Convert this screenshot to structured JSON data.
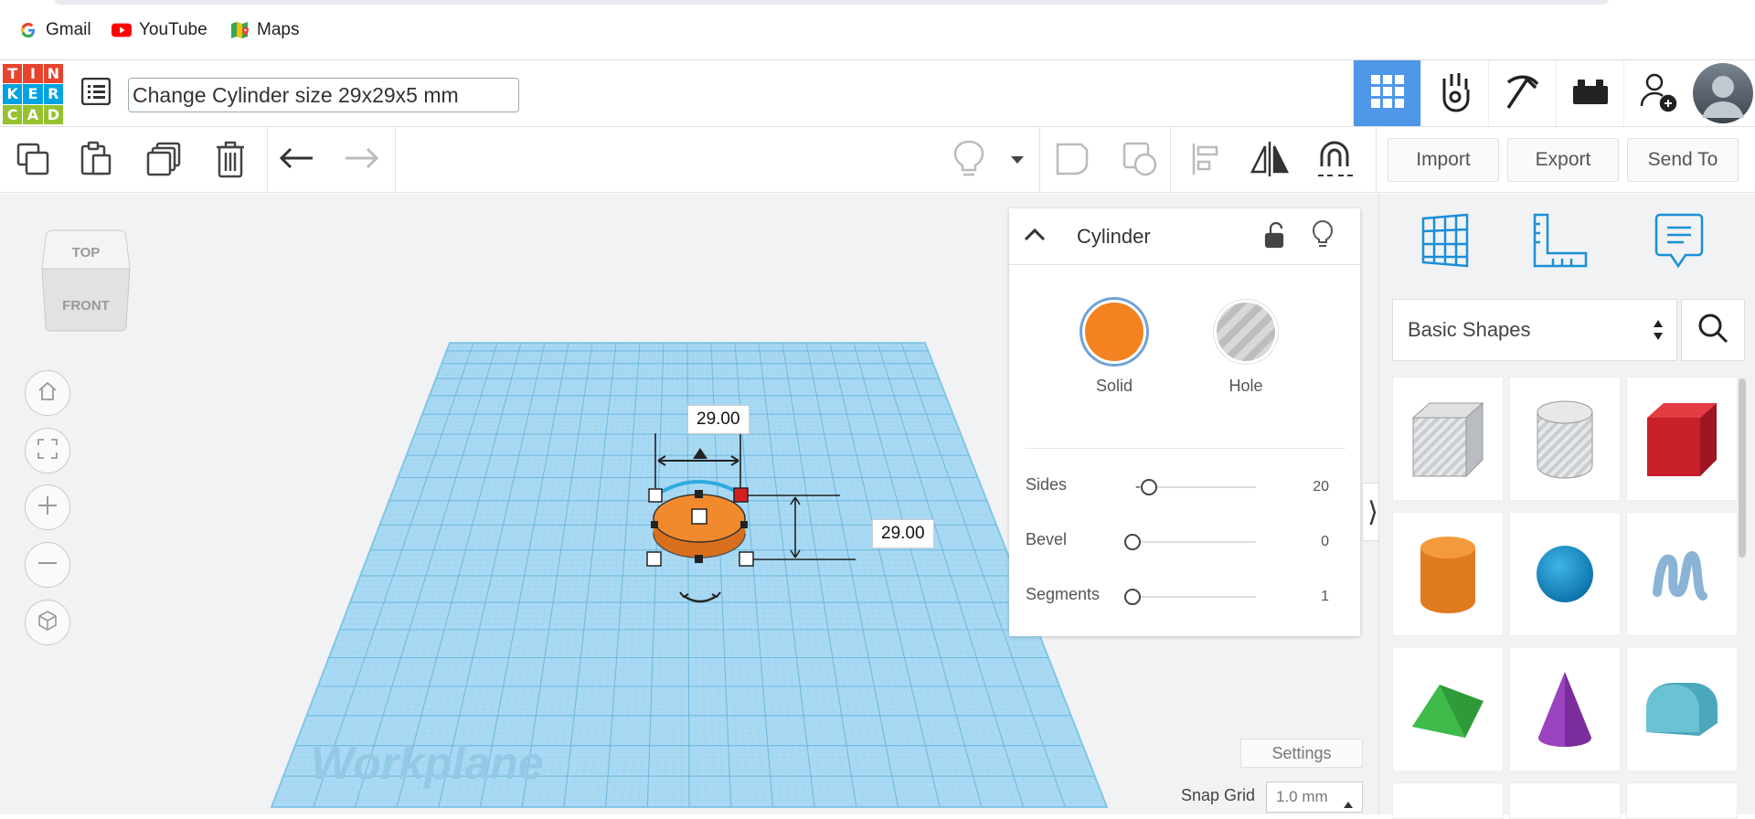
{
  "bookmarks": [
    {
      "label": "Gmail",
      "icon": "google-icon"
    },
    {
      "label": "YouTube",
      "icon": "youtube-icon"
    },
    {
      "label": "Maps",
      "icon": "maps-icon"
    }
  ],
  "header": {
    "logo_letters": [
      "T",
      "I",
      "N",
      "K",
      "E",
      "R",
      "C",
      "A",
      "D"
    ],
    "logo_colors": [
      "#e7442c",
      "#e7442c",
      "#e7442c",
      "#00a2e1",
      "#00a2e1",
      "#00a2e1",
      "#96c22f",
      "#96c22f",
      "#96c22f"
    ],
    "design_title": "Change Cylinder size 29x29x5 mm"
  },
  "toolbar": {
    "import_label": "Import",
    "export_label": "Export",
    "sendto_label": "Send To"
  },
  "viewcube": {
    "top": "TOP",
    "front": "FRONT"
  },
  "workplane": {
    "label": "Workplane"
  },
  "dimensions": {
    "width": "29.00",
    "length": "29.00"
  },
  "inspector": {
    "title": "Cylinder",
    "solid_label": "Solid",
    "hole_label": "Hole",
    "solid_color": "#f58220",
    "properties": [
      {
        "label": "Sides",
        "value": "20"
      },
      {
        "label": "Bevel",
        "value": "0"
      },
      {
        "label": "Segments",
        "value": "1"
      }
    ]
  },
  "settings_label": "Settings",
  "snap": {
    "label": "Snap Grid",
    "value": "1.0 mm"
  },
  "shapes_panel": {
    "category": "Basic Shapes",
    "shapes": [
      "box-hole",
      "cylinder-hole",
      "box",
      "cylinder",
      "sphere",
      "scribble",
      "roof",
      "cone",
      "round-roof"
    ]
  }
}
